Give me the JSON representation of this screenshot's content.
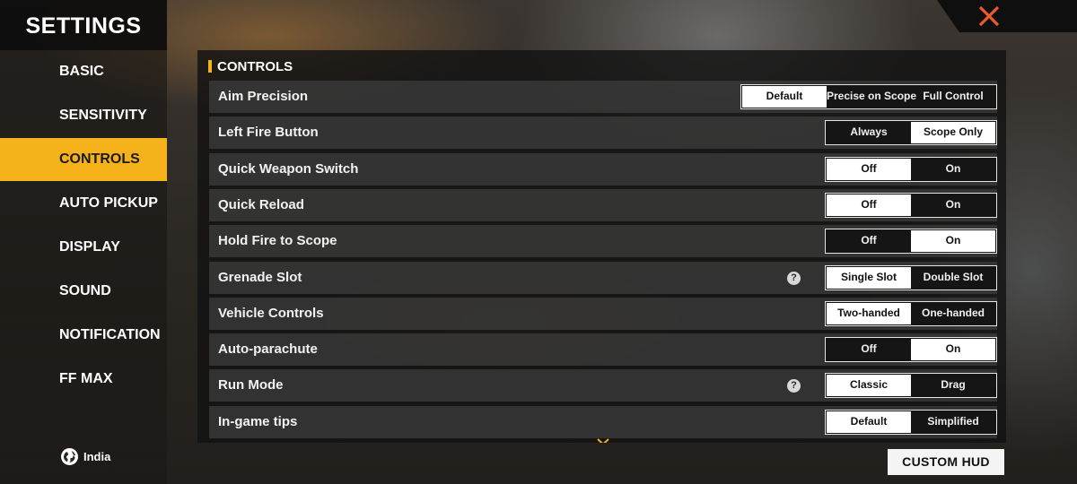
{
  "sidebar": {
    "title": "SETTINGS",
    "items": [
      {
        "label": "BASIC",
        "active": false
      },
      {
        "label": "SENSITIVITY",
        "active": false
      },
      {
        "label": "CONTROLS",
        "active": true
      },
      {
        "label": "AUTO PICKUP",
        "active": false
      },
      {
        "label": "DISPLAY",
        "active": false
      },
      {
        "label": "SOUND",
        "active": false
      },
      {
        "label": "NOTIFICATION",
        "active": false
      },
      {
        "label": "FF MAX",
        "active": false
      }
    ],
    "region": "India"
  },
  "panel": {
    "title": "CONTROLS",
    "rows": [
      {
        "label": "Aim Precision",
        "help": false,
        "options": [
          "Default",
          "Precise on Scope",
          "Full Control"
        ],
        "selected": 0
      },
      {
        "label": "Left Fire Button",
        "help": false,
        "options": [
          "Always",
          "Scope Only"
        ],
        "selected": 1
      },
      {
        "label": "Quick Weapon Switch",
        "help": false,
        "options": [
          "Off",
          "On"
        ],
        "selected": 0
      },
      {
        "label": "Quick Reload",
        "help": false,
        "options": [
          "Off",
          "On"
        ],
        "selected": 0
      },
      {
        "label": "Hold Fire to Scope",
        "help": false,
        "options": [
          "Off",
          "On"
        ],
        "selected": 1
      },
      {
        "label": "Grenade Slot",
        "help": true,
        "options": [
          "Single Slot",
          "Double Slot"
        ],
        "selected": 0
      },
      {
        "label": "Vehicle Controls",
        "help": false,
        "options": [
          "Two-handed",
          "One-handed"
        ],
        "selected": 0
      },
      {
        "label": "Auto-parachute",
        "help": false,
        "options": [
          "Off",
          "On"
        ],
        "selected": 1
      },
      {
        "label": "Run Mode",
        "help": true,
        "options": [
          "Classic",
          "Drag"
        ],
        "selected": 0
      },
      {
        "label": "In-game tips",
        "help": false,
        "options": [
          "Default",
          "Simplified"
        ],
        "selected": 0
      }
    ]
  },
  "help_glyph": "?",
  "custom_hud_label": "CUSTOM HUD",
  "colors": {
    "accent": "#f6b21a",
    "selected_bg": "#ffffff",
    "panel_bg": "#121212"
  }
}
